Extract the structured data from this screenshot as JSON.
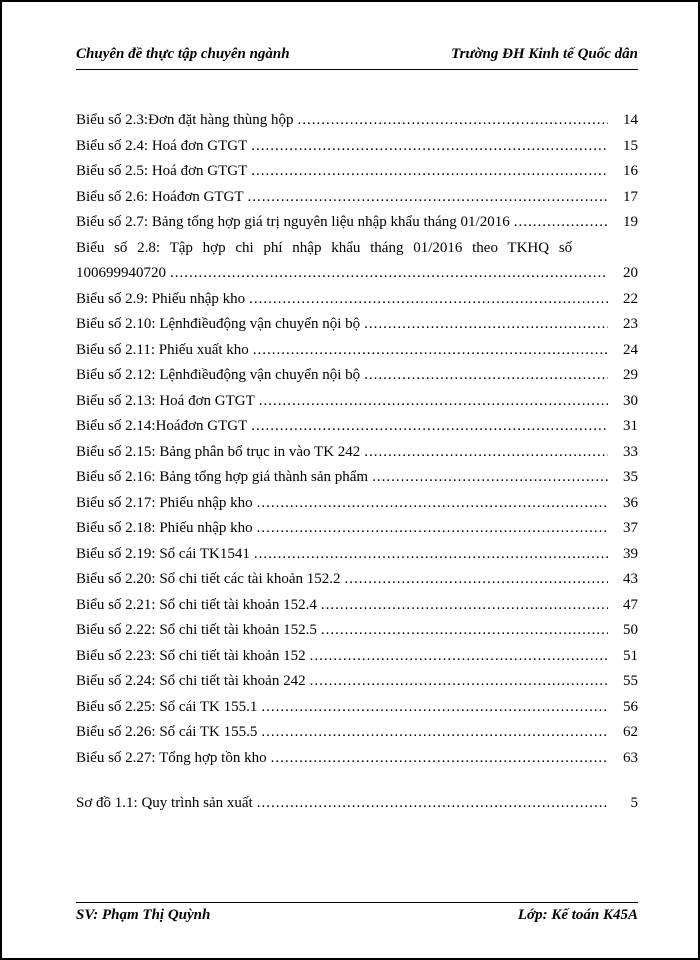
{
  "header": {
    "left": "Chuyên đề thực tập chuyên ngành",
    "right": "Trường ĐH Kinh tế Quốc dân"
  },
  "toc": [
    {
      "label": "Biểu số 2.3:Đơn đặt hàng thùng hộp",
      "page": "14"
    },
    {
      "label": "Biểu số 2.4: Hoá đơn GTGT",
      "page": "15"
    },
    {
      "label": "Biểu số 2.5: Hoá đơn GTGT",
      "page": "16"
    },
    {
      "label": "Biểu số 2.6: Hoáđơn GTGT",
      "page": "17"
    },
    {
      "label": "Biểu số 2.7: Bảng tổng hợp giá trị nguyên liệu nhập khẩu tháng 01/2016",
      "page": "19"
    },
    {
      "label": "Biểu số 2.8: Tập hợp chi phí nhập khẩu  tháng 01/2016 theo TKHQ số",
      "wrap": "100699940720",
      "page": "20"
    },
    {
      "label": "Biểu số 2.9: Phiếu nhập kho",
      "page": "22"
    },
    {
      "label": "Biểu số 2.10: Lệnhđiềuđộng vận chuyển nội bộ",
      "page": "23"
    },
    {
      "label": "Biểu số 2.11: Phiếu xuất kho",
      "page": "24"
    },
    {
      "label": "Biểu số 2.12: Lệnhđiềuđộng vận chuyển nội bộ",
      "page": "29"
    },
    {
      "label": "Biểu số 2.13: Hoá đơn GTGT",
      "page": "30"
    },
    {
      "label": "Biểu số 2.14:Hoáđơn GTGT",
      "page": "31"
    },
    {
      "label": "Biểu số 2.15: Bảng phân bổ trục in vào TK 242",
      "page": "33"
    },
    {
      "label": "Biểu số 2.16: Bảng tổng hợp giá thành sản phẩm",
      "page": "35"
    },
    {
      "label": "Biểu số 2.17: Phiếu nhập kho",
      "page": "36"
    },
    {
      "label": "Biểu số 2.18: Phiếu nhập kho",
      "page": "37"
    },
    {
      "label": "Biểu số 2.19: Sổ cái TK1541",
      "page": "39"
    },
    {
      "label": "Biểu số 2.20: Sổ chi tiết các tài khoản 152.2",
      "page": "43"
    },
    {
      "label": "Biểu số 2.21: Sổ chi tiết tài khoản 152.4",
      "page": "47"
    },
    {
      "label": "Biểu số 2.22: Sổ chi tiết tài khoản 152.5",
      "page": "50"
    },
    {
      "label": "Biểu số 2.23: Sổ chi tiết tài khoản 152",
      "page": "51"
    },
    {
      "label": "Biểu số 2.24: Sổ chi tiết tài khoản 242",
      "page": "55"
    },
    {
      "label": "Biểu số 2.25: Sổ cái TK 155.1",
      "page": "56"
    },
    {
      "label": "Biểu số 2.26: Sổ cái TK 155.5",
      "page": "62"
    },
    {
      "label": "Biểu số 2.27: Tổng hợp tồn kho",
      "page": "63"
    }
  ],
  "toc2": [
    {
      "label": "Sơ đồ 1.1: Quy trình sản xuất",
      "page": "5"
    }
  ],
  "footer": {
    "left": "SV: Phạm Thị Quỳnh",
    "right": "Lớp: Kế toán K45A"
  }
}
